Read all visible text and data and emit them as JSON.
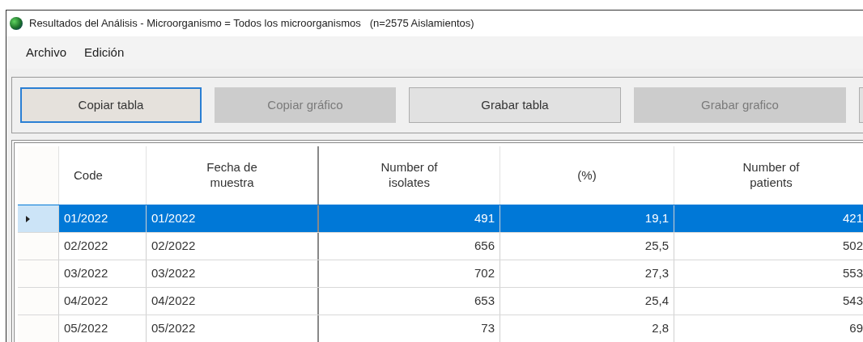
{
  "window": {
    "title": "Resultados del Análisis - Microorganismo = Todos los microorganismos   (n=2575 Aislamientos)"
  },
  "menu": [
    "Archivo",
    "Edición"
  ],
  "toolbar": [
    {
      "label": "Copiar tabla",
      "disabled": false,
      "focused": true
    },
    {
      "label": "Copiar gráfico",
      "disabled": true,
      "focused": false
    },
    {
      "label": "Grabar tabla",
      "disabled": false,
      "focused": false
    },
    {
      "label": "Grabar grafico",
      "disabled": true,
      "focused": false
    }
  ],
  "table": {
    "columns": [
      "Code",
      "Fecha de muestra",
      "Number of isolates",
      "(%)",
      "Number of patients"
    ],
    "rows": [
      {
        "cells": [
          "01/2022",
          "01/2022",
          "491",
          "19,1",
          "421"
        ],
        "selected": true
      },
      {
        "cells": [
          "02/2022",
          "02/2022",
          "656",
          "25,5",
          "502"
        ],
        "selected": false
      },
      {
        "cells": [
          "03/2022",
          "03/2022",
          "702",
          "27,3",
          "553"
        ],
        "selected": false
      },
      {
        "cells": [
          "04/2022",
          "04/2022",
          "653",
          "25,4",
          "543"
        ],
        "selected": false
      },
      {
        "cells": [
          "05/2022",
          "05/2022",
          "73",
          "2,8",
          "69"
        ],
        "selected": false
      }
    ]
  }
}
